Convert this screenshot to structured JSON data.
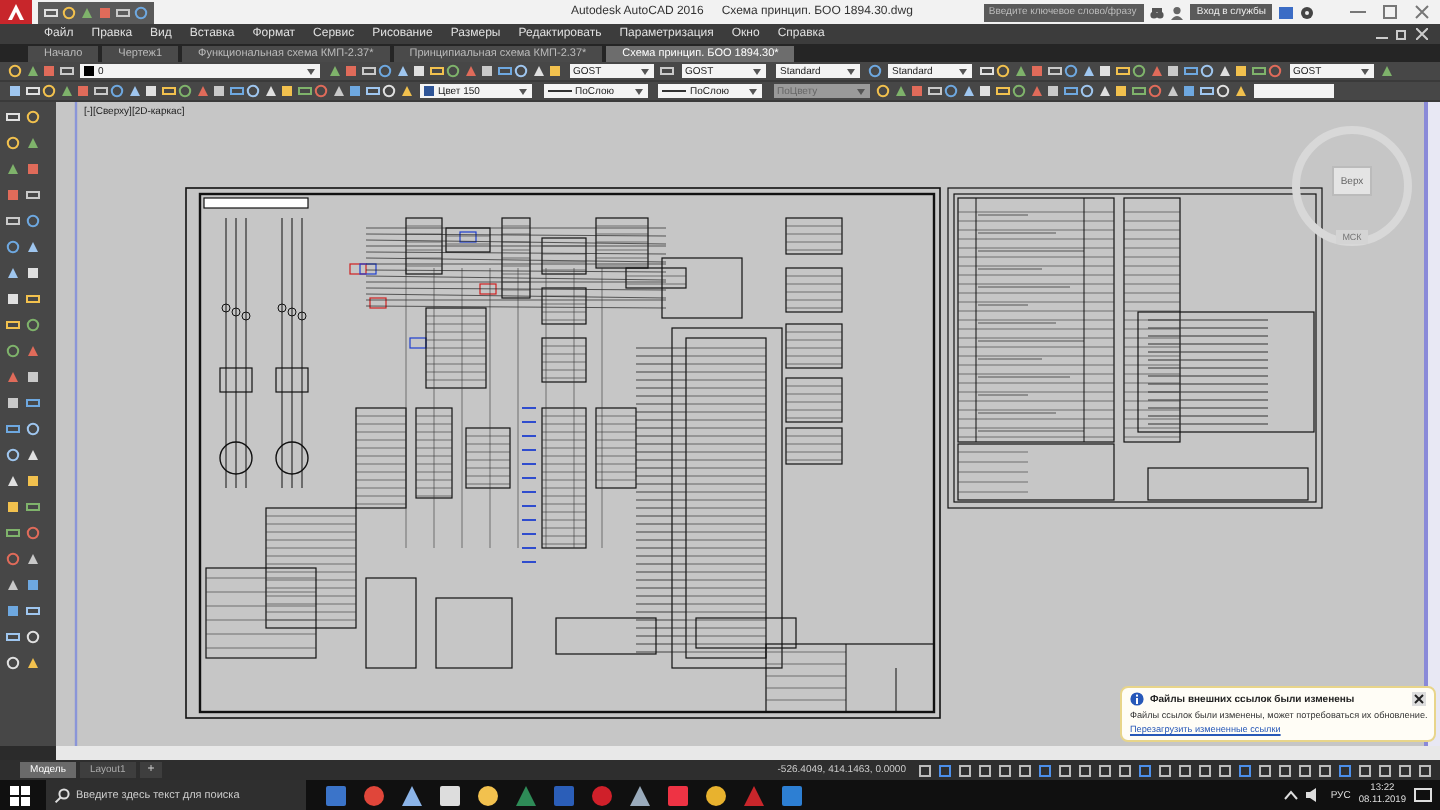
{
  "window": {
    "app": "Autodesk AutoCAD 2016",
    "file": "Схема принцип. БОО 1894.30.dwg"
  },
  "search": {
    "placeholder": "Введите ключевое слово/фразу"
  },
  "sign_in": "Вход в службы",
  "menu": [
    "Файл",
    "Правка",
    "Вид",
    "Вставка",
    "Формат",
    "Сервис",
    "Рисование",
    "Размеры",
    "Редактировать",
    "Параметризация",
    "Окно",
    "Справка"
  ],
  "doc_tabs": [
    {
      "label": "Начало",
      "selected": false
    },
    {
      "label": "Чертеж1",
      "selected": false
    },
    {
      "label": "Функциональная схема КМП-2.37*",
      "selected": false
    },
    {
      "label": "Принципиальная схема КМП-2.37*",
      "selected": false
    },
    {
      "label": "Схема принцип. БОО 1894.30*",
      "selected": true
    }
  ],
  "toolbar": {
    "layer": "0",
    "text_style": "GOST",
    "dim_style": "GOST",
    "table_style": "Standard",
    "mleader_style": "Standard",
    "multiline_style": "GOST",
    "color_setting": "Цвет 150",
    "linetype": "ПоСлою",
    "lineweight": "ПоСлою",
    "plot_style": "ПоЦвету"
  },
  "viewport": {
    "label": "[-][Сверху][2D-каркас]",
    "viewcube": "Верх",
    "ucs": "МСК"
  },
  "layout_tabs": [
    {
      "label": "Модель",
      "selected": true
    },
    {
      "label": "Layout1",
      "selected": false
    }
  ],
  "add_tab": "+",
  "status_bar": {
    "coordinates": "-526.4049, 414.1463, 0.0000"
  },
  "notification": {
    "title": "Файлы внешних ссылок были изменены",
    "message": "Файлы ссылок были изменены, может потребоваться их обновление.",
    "link": "Перезагрузить измененные ссылки"
  },
  "taskbar": {
    "search_placeholder": "Введите здесь текст для поиска",
    "language": "РУС",
    "time": "13:22",
    "date": "08.11.2019"
  }
}
